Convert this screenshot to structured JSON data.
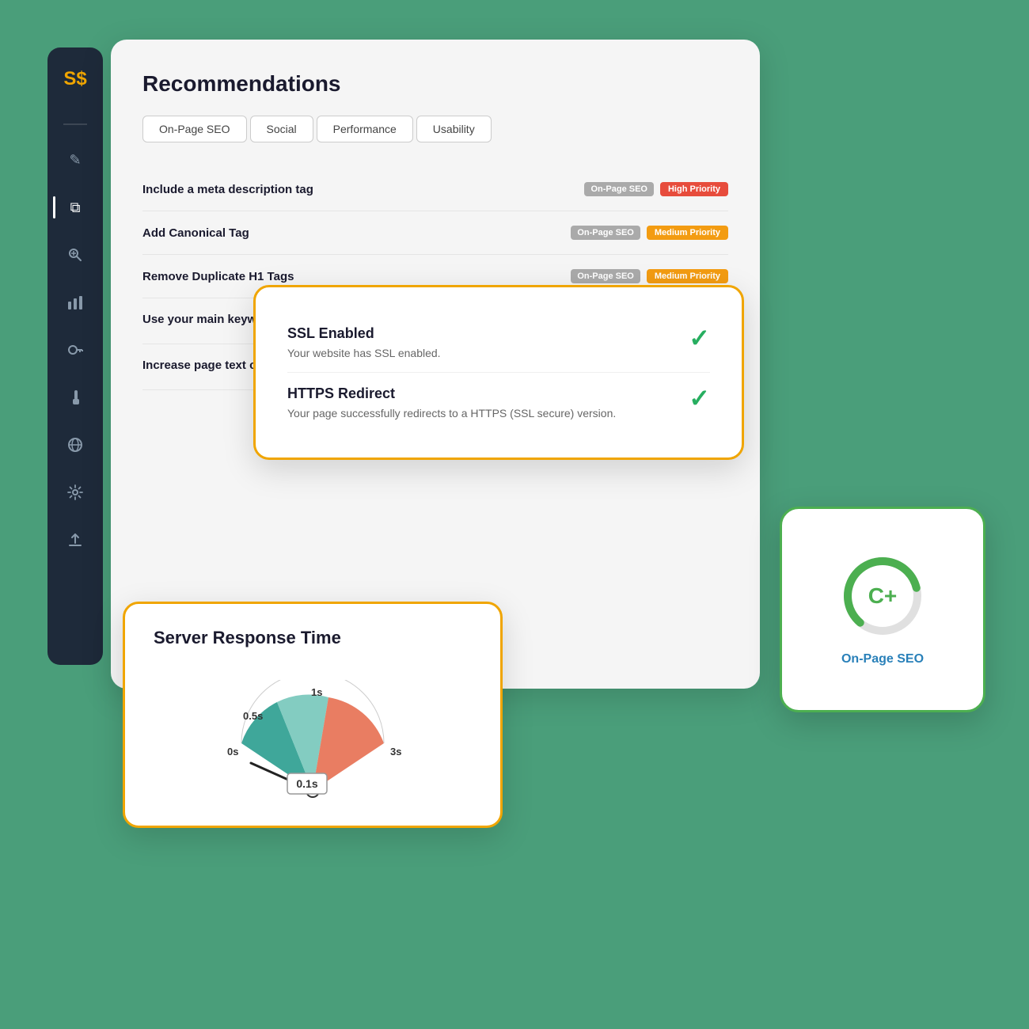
{
  "sidebar": {
    "logo": "S$",
    "icons": [
      {
        "name": "edit-icon",
        "symbol": "✎",
        "active": false
      },
      {
        "name": "copy-icon",
        "symbol": "❏",
        "active": true
      },
      {
        "name": "search-icon",
        "symbol": "⊕",
        "active": false
      },
      {
        "name": "chart-icon",
        "symbol": "▮",
        "active": false
      },
      {
        "name": "key-icon",
        "symbol": "⚷",
        "active": false
      },
      {
        "name": "tool-icon",
        "symbol": "⚒",
        "active": false
      },
      {
        "name": "globe-icon",
        "symbol": "⊕",
        "active": false
      },
      {
        "name": "settings-icon",
        "symbol": "⚙",
        "active": false
      },
      {
        "name": "upload-icon",
        "symbol": "⬆",
        "active": false
      }
    ]
  },
  "main": {
    "title": "Recommendations",
    "tabs": [
      {
        "label": "On-Page SEO",
        "active": false
      },
      {
        "label": "Social",
        "active": false
      },
      {
        "label": "Performance",
        "active": false
      },
      {
        "label": "Usability",
        "active": false
      }
    ],
    "recommendations": [
      {
        "label": "Include a meta description tag",
        "tag_seo": "On-Page SEO",
        "tag_priority": "High Priority",
        "priority_class": "high"
      },
      {
        "label": "Add Canonical Tag",
        "tag_seo": "On-Page SEO",
        "tag_priority": "Medium Priority",
        "priority_class": "medium"
      },
      {
        "label": "Remove Duplicate H1 Tags",
        "tag_seo": "On-Page SEO",
        "tag_priority": "Medium Priority",
        "priority_class": "medium"
      },
      {
        "label": "Use your main keyword in your heading tags",
        "sub": "",
        "tag_seo": "",
        "tag_priority": "",
        "priority_class": "none"
      },
      {
        "label": "Increase page text content",
        "sub": "",
        "tag_seo": "",
        "tag_priority": "",
        "priority_class": "none"
      }
    ]
  },
  "ssl_card": {
    "items": [
      {
        "title": "SSL Enabled",
        "description": "Your website has SSL enabled."
      },
      {
        "title": "HTTPS Redirect",
        "description": "Your page successfully redirects to a HTTPS (SSL secure) version."
      }
    ]
  },
  "score_card": {
    "grade": "C+",
    "label": "On-Page SEO",
    "progress": 60
  },
  "gauge_card": {
    "title": "Server Response Time",
    "value": "0.1s",
    "labels": [
      "0s",
      "0.5s",
      "1s",
      "3s"
    ]
  }
}
